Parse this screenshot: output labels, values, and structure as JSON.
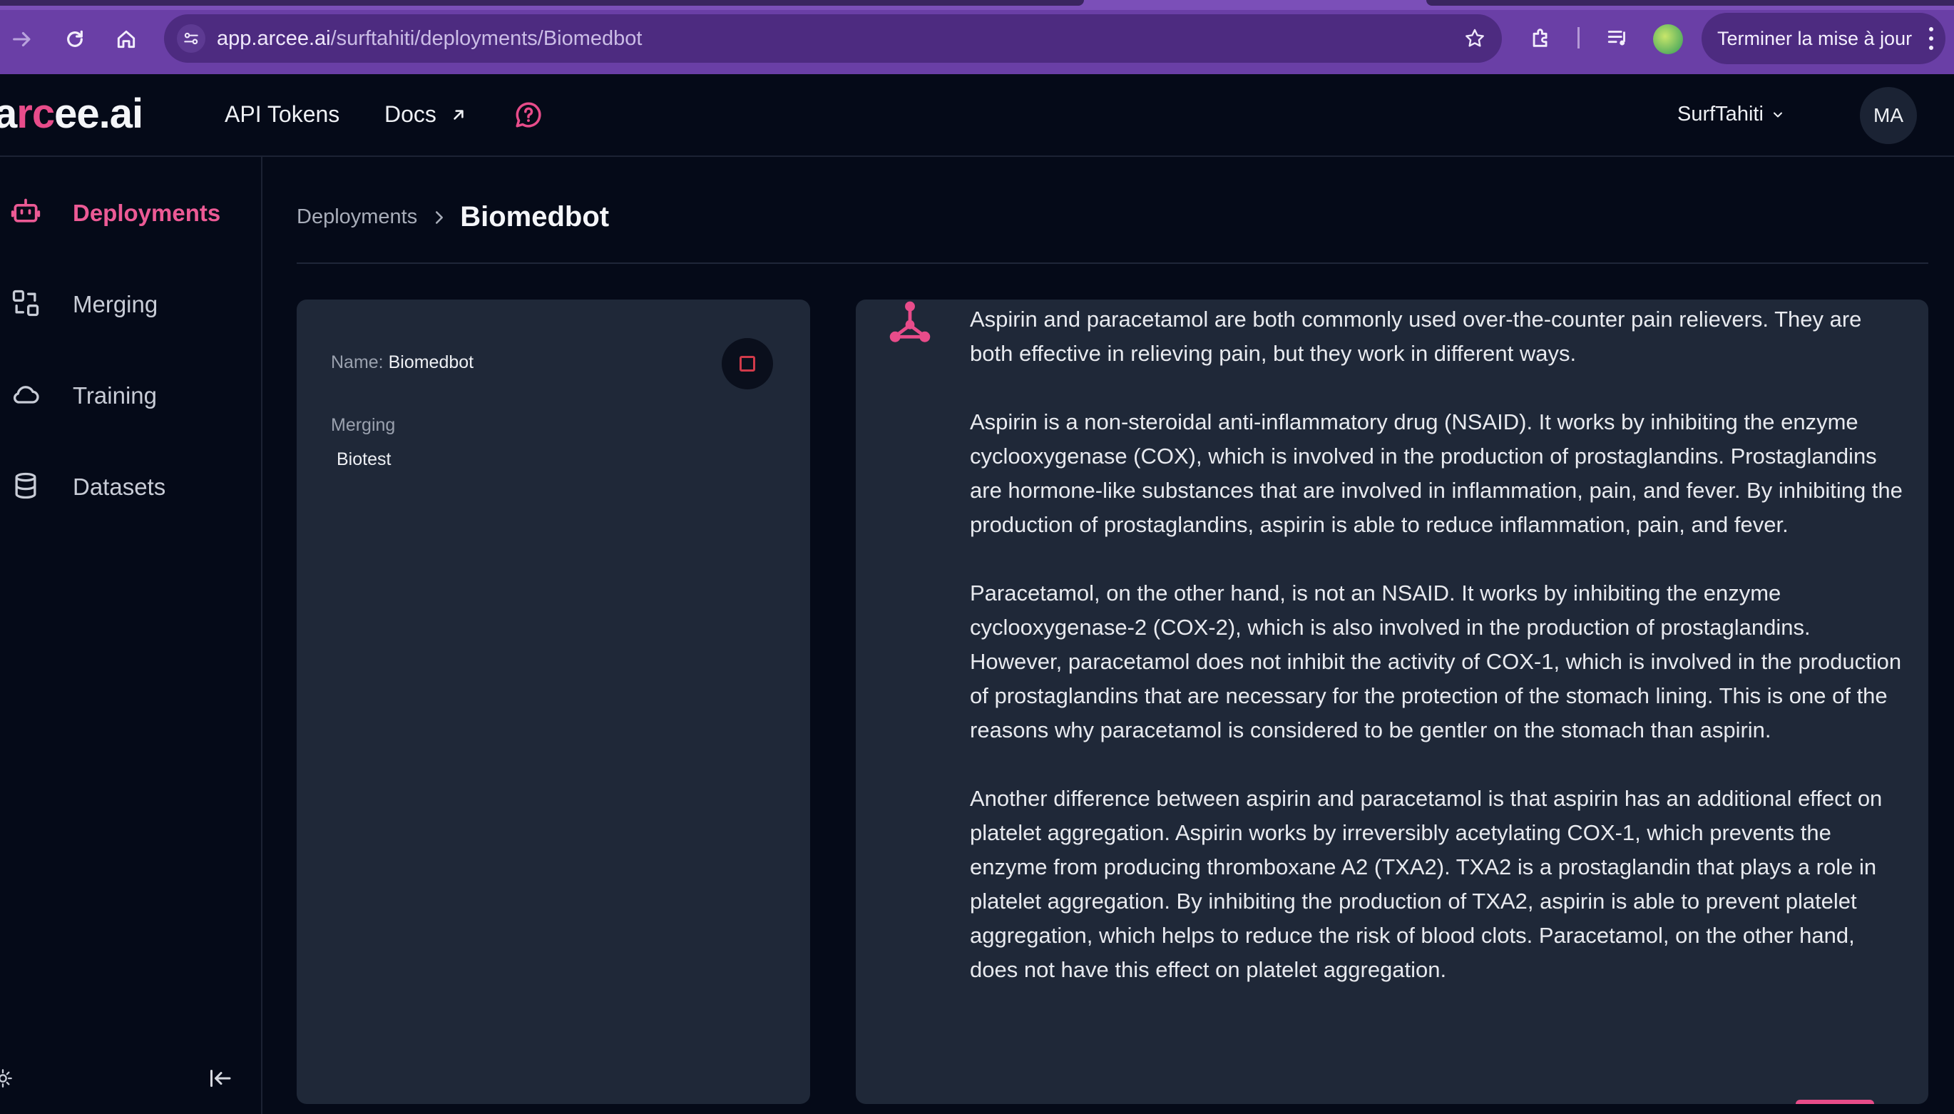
{
  "browser": {
    "url_host": "app.arcee.ai",
    "url_path": "/surftahiti/deployments/Biomedbot",
    "update_button": "Terminer la mise à jour"
  },
  "header": {
    "logo_prefix": "a",
    "logo_accent": "rc",
    "logo_suffix": "ee.ai",
    "nav": {
      "api_tokens": "API Tokens",
      "docs": "Docs"
    },
    "workspace": "SurfTahiti",
    "avatar_initials": "MA"
  },
  "sidebar": {
    "items": [
      {
        "label": "Deployments",
        "icon": "robot-icon",
        "active": true
      },
      {
        "label": "Merging",
        "icon": "merge-icon",
        "active": false
      },
      {
        "label": "Training",
        "icon": "cloud-icon",
        "active": false
      },
      {
        "label": "Datasets",
        "icon": "database-icon",
        "active": false
      }
    ]
  },
  "breadcrumb": {
    "parent": "Deployments",
    "current": "Biomedbot"
  },
  "deployment": {
    "name_label": "Name:",
    "name_value": "Biomedbot",
    "merging_label": "Merging",
    "merging_value": "Biotest"
  },
  "chat": {
    "paragraphs": [
      "Aspirin and paracetamol are both commonly used over-the-counter pain relievers. They are both effective in relieving pain, but they work in different ways.",
      "Aspirin is a non-steroidal anti-inflammatory drug (NSAID). It works by inhibiting the enzyme cyclooxygenase (COX), which is involved in the production of prostaglandins. Prostaglandins are hormone-like substances that are involved in inflammation, pain, and fever. By inhibiting the production of prostaglandins, aspirin is able to reduce inflammation, pain, and fever.",
      "Paracetamol, on the other hand, is not an NSAID. It works by inhibiting the enzyme cyclooxygenase-2 (COX-2), which is also involved in the production of prostaglandins. However, paracetamol does not inhibit the activity of COX-1, which is involved in the production of prostaglandins that are necessary for the protection of the stomach lining. This is one of the reasons why paracetamol is considered to be gentler on the stomach than aspirin.",
      "Another difference between aspirin and paracetamol is that aspirin has an additional effect on platelet aggregation. Aspirin works by irreversibly acetylating COX-1, which prevents the enzyme from producing thromboxane A2 (TXA2). TXA2 is a prostaglandin that plays a role in platelet aggregation. By inhibiting the production of TXA2, aspirin is able to prevent platelet aggregation, which helps to reduce the risk of blood clots. Paracetamol, on the other hand, does not have this effect on platelet aggregation."
    ]
  },
  "colors": {
    "accent": "#e84c8a",
    "background": "#050a18",
    "card": "#1f2838",
    "chrome": "#6a3fa6"
  }
}
